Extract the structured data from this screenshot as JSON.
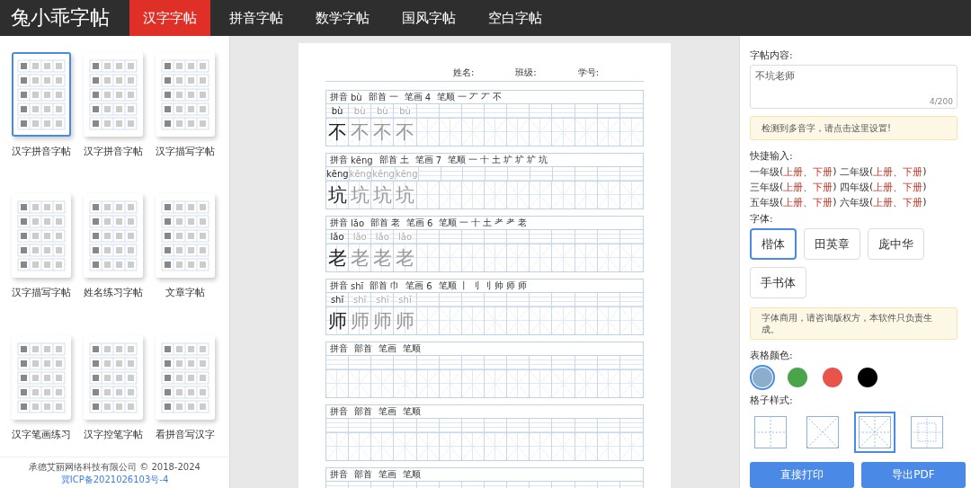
{
  "header": {
    "logo": "兔小乖字帖",
    "tabs": [
      {
        "label": "汉字字帖",
        "selected": true
      },
      {
        "label": "拼音字帖",
        "selected": false
      },
      {
        "label": "数学字帖",
        "selected": false
      },
      {
        "label": "国风字帖",
        "selected": false
      },
      {
        "label": "空白字帖",
        "selected": false
      }
    ]
  },
  "sidebar": {
    "templates": [
      {
        "label": "汉字拼音字帖",
        "selected": true
      },
      {
        "label": "汉字拼音字帖",
        "selected": false
      },
      {
        "label": "汉字描写字帖",
        "selected": false
      },
      {
        "label": "汉字描写字帖",
        "selected": false
      },
      {
        "label": "姓名练习字帖",
        "selected": false
      },
      {
        "label": "文章字帖",
        "selected": false
      },
      {
        "label": "汉字笔画练习",
        "selected": false
      },
      {
        "label": "汉字控笔字帖",
        "selected": false
      },
      {
        "label": "看拼音写汉字",
        "selected": false
      }
    ],
    "footer": {
      "text": "承德艾丽网络科技有限公司 © 2018-2024",
      "link": "冀ICP备2021026103号-4"
    }
  },
  "sheet": {
    "fields": [
      "姓名:",
      "班级:",
      "学号:"
    ],
    "rows": [
      {
        "pinyin_label": "拼音",
        "pinyin": "bù",
        "radical_label": "部首",
        "radical": "一",
        "strokes_label": "笔画",
        "stroke_count": "4",
        "order_label": "笔顺",
        "order": [
          "一",
          "丆",
          "丆",
          "不"
        ],
        "pinyin_cells": [
          "bù",
          "bù",
          "bù",
          "bù"
        ],
        "char_cells": [
          "不",
          "不",
          "不",
          "不"
        ]
      },
      {
        "pinyin_label": "拼音",
        "pinyin": "kēng",
        "radical_label": "部首",
        "radical": "土",
        "strokes_label": "笔画",
        "stroke_count": "7",
        "order_label": "笔顺",
        "order": [
          "一",
          "十",
          "土",
          "圹",
          "圹",
          "圹",
          "坑"
        ],
        "pinyin_cells": [
          "kēng",
          "kēng",
          "kēng",
          "kēng"
        ],
        "char_cells": [
          "坑",
          "坑",
          "坑",
          "坑"
        ]
      },
      {
        "pinyin_label": "拼音",
        "pinyin": "lǎo",
        "radical_label": "部首",
        "radical": "老",
        "strokes_label": "笔画",
        "stroke_count": "6",
        "order_label": "笔顺",
        "order": [
          "一",
          "十",
          "土",
          "耂",
          "耂",
          "老"
        ],
        "pinyin_cells": [
          "lǎo",
          "lǎo",
          "lǎo",
          "lǎo"
        ],
        "char_cells": [
          "老",
          "老",
          "老",
          "老"
        ]
      },
      {
        "pinyin_label": "拼音",
        "pinyin": "shī",
        "radical_label": "部首",
        "radical": "巾",
        "strokes_label": "笔画",
        "stroke_count": "6",
        "order_label": "笔顺",
        "order": [
          "丨",
          "刂",
          "刂",
          "帅",
          "师",
          "师"
        ],
        "pinyin_cells": [
          "shī",
          "shī",
          "shī",
          "shī"
        ],
        "char_cells": [
          "师",
          "师",
          "师",
          "师"
        ]
      },
      {
        "pinyin_label": "拼音",
        "radical_label": "部首",
        "strokes_label": "笔画",
        "order_label": "笔顺"
      },
      {
        "pinyin_label": "拼音",
        "radical_label": "部首",
        "strokes_label": "笔画",
        "order_label": "笔顺"
      },
      {
        "pinyin_label": "拼音",
        "radical_label": "部首",
        "strokes_label": "笔画",
        "order_label": "笔顺"
      }
    ]
  },
  "settings": {
    "content_label": "字帖内容:",
    "content": "不坑老师",
    "counter": "4/200",
    "polyphone_notice": "检测到多音字，请点击这里设置!",
    "quick_label": "快捷输入:",
    "grades": [
      {
        "grade": "一年级",
        "open": "(",
        "upper": "上册",
        "sep": "、",
        "lower": "下册",
        "close": ")"
      },
      {
        "grade": "二年级",
        "open": "(",
        "upper": "上册",
        "sep": "、",
        "lower": "下册",
        "close": ")"
      },
      {
        "grade": "三年级",
        "open": "(",
        "upper": "上册",
        "sep": "、",
        "lower": "下册",
        "close": ")"
      },
      {
        "grade": "四年级",
        "open": "(",
        "upper": "上册",
        "sep": "、",
        "lower": "下册",
        "close": ")"
      },
      {
        "grade": "五年级",
        "open": "(",
        "upper": "上册",
        "sep": "、",
        "lower": "下册",
        "close": ")"
      },
      {
        "grade": "六年级",
        "open": "(",
        "upper": "上册",
        "sep": "、",
        "lower": "下册",
        "close": ")"
      }
    ],
    "font_label": "字体:",
    "fonts": [
      {
        "label": "楷体",
        "selected": true
      },
      {
        "label": "田英章",
        "selected": false
      },
      {
        "label": "庞中华",
        "selected": false
      },
      {
        "label": "手书体",
        "selected": false
      }
    ],
    "font_notice": "字体商用，请咨询版权方，本软件只负责生成。",
    "color_label": "表格颜色:",
    "colors": [
      {
        "color": "#8aaecb",
        "selected": true
      },
      {
        "color": "#4aa44a",
        "selected": false
      },
      {
        "color": "#e8534b",
        "selected": false
      },
      {
        "color": "#000000",
        "selected": false
      }
    ],
    "style_label": "格子样式:",
    "grid_styles": [
      {
        "kind": "tian",
        "selected": false
      },
      {
        "kind": "cross",
        "selected": false
      },
      {
        "kind": "mi",
        "selected": true
      },
      {
        "kind": "frame",
        "selected": false
      }
    ],
    "buttons": [
      "直接打印",
      "导出PDF"
    ]
  }
}
